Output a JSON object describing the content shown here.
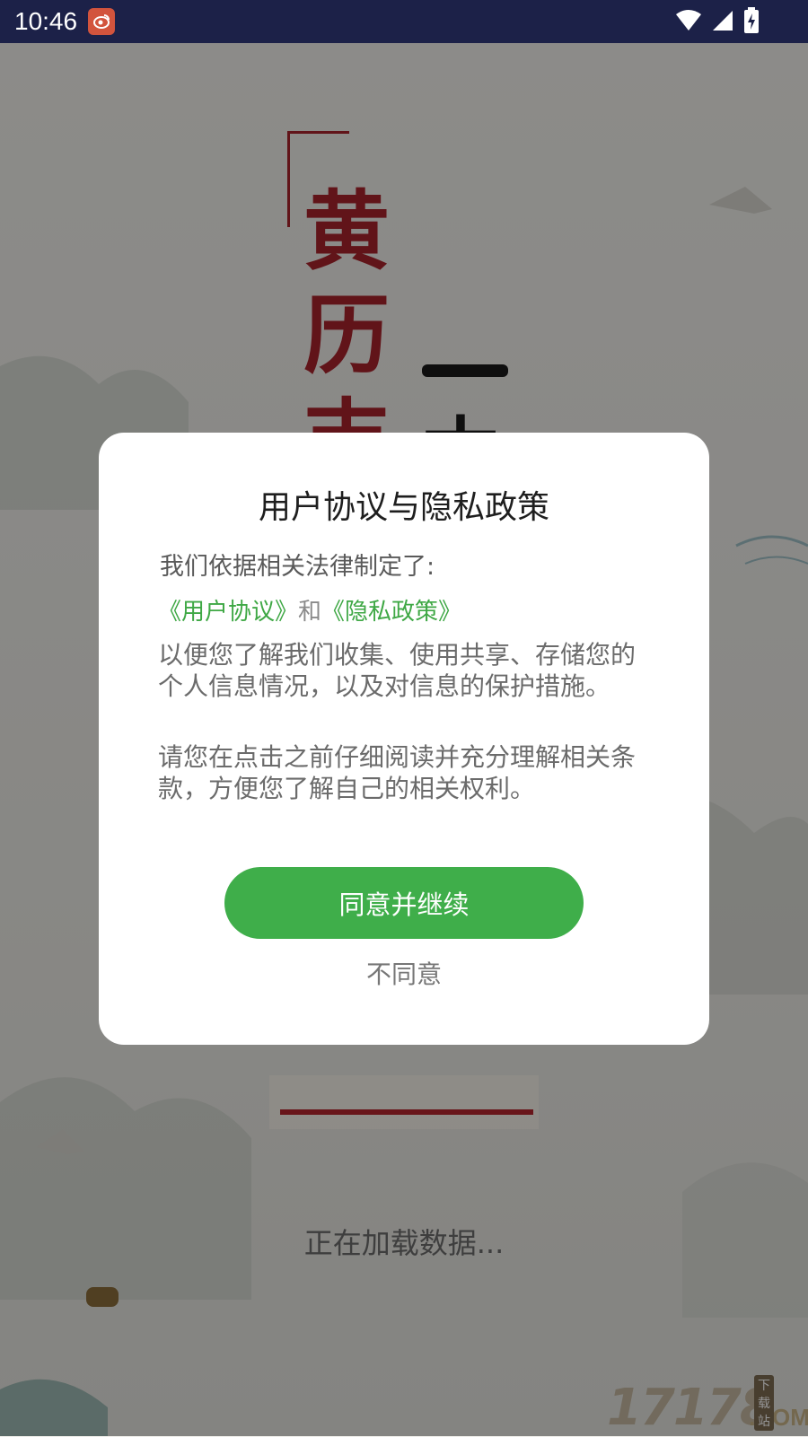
{
  "status_bar": {
    "time": "10:46",
    "notification_icon": "weibo-app-icon",
    "icons": [
      "wifi-icon",
      "signal-icon",
      "battery-charging-icon"
    ]
  },
  "background": {
    "hero_chars": [
      "黄",
      "历",
      "吉"
    ],
    "hero_right_chars": [
      "一",
      "本"
    ],
    "loading_text": "正在加载数据...",
    "watermark": {
      "number": "17178",
      "domain": ".COM",
      "site_label": "下载站"
    }
  },
  "dialog": {
    "title": "用户协议与隐私政策",
    "intro": "我们依据相关法律制定了:",
    "link_user_agreement": "《用户协议》",
    "link_joiner": "和",
    "link_privacy_policy": "《隐私政策》",
    "paragraph1": "以便您了解我们收集、使用共享、存储您的个人信息情况，以及对信息的保护措施。",
    "paragraph2": "请您在点击之前仔细阅读并充分理解相关条款，方便您了解自己的相关权利。",
    "agree_button": "同意并继续",
    "disagree_button": "不同意"
  },
  "colors": {
    "status_bar_bg": "#1c2148",
    "accent_green": "#3fae4a",
    "link_green": "#3fa845",
    "hero_red": "#a8232b"
  }
}
